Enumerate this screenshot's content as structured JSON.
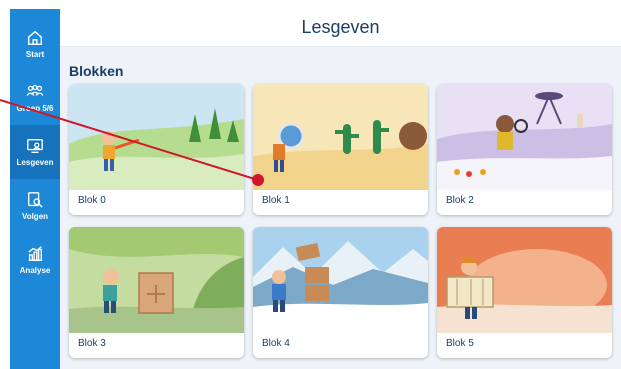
{
  "sidebar": {
    "items": [
      {
        "label": "Start",
        "icon": "home-icon"
      },
      {
        "label": "Groep 5/6",
        "icon": "group-icon"
      },
      {
        "label": "Lesgeven",
        "icon": "teach-icon",
        "active": true
      },
      {
        "label": "Volgen",
        "icon": "follow-icon"
      },
      {
        "label": "Analyse",
        "icon": "chart-icon"
      }
    ]
  },
  "header": {
    "title": "Lesgeven"
  },
  "main": {
    "section_title": "Blokken",
    "blocks": [
      {
        "label": "Blok 0"
      },
      {
        "label": "Blok 1"
      },
      {
        "label": "Blok 2"
      },
      {
        "label": "Blok 3"
      },
      {
        "label": "Blok 4"
      },
      {
        "label": "Blok 5"
      }
    ]
  },
  "colors": {
    "sidebar": "#1e88d8",
    "sidebar_active": "#1672bd",
    "background": "#eef3f9",
    "title_text": "#1b3e63",
    "annotation": "#d0162b"
  }
}
